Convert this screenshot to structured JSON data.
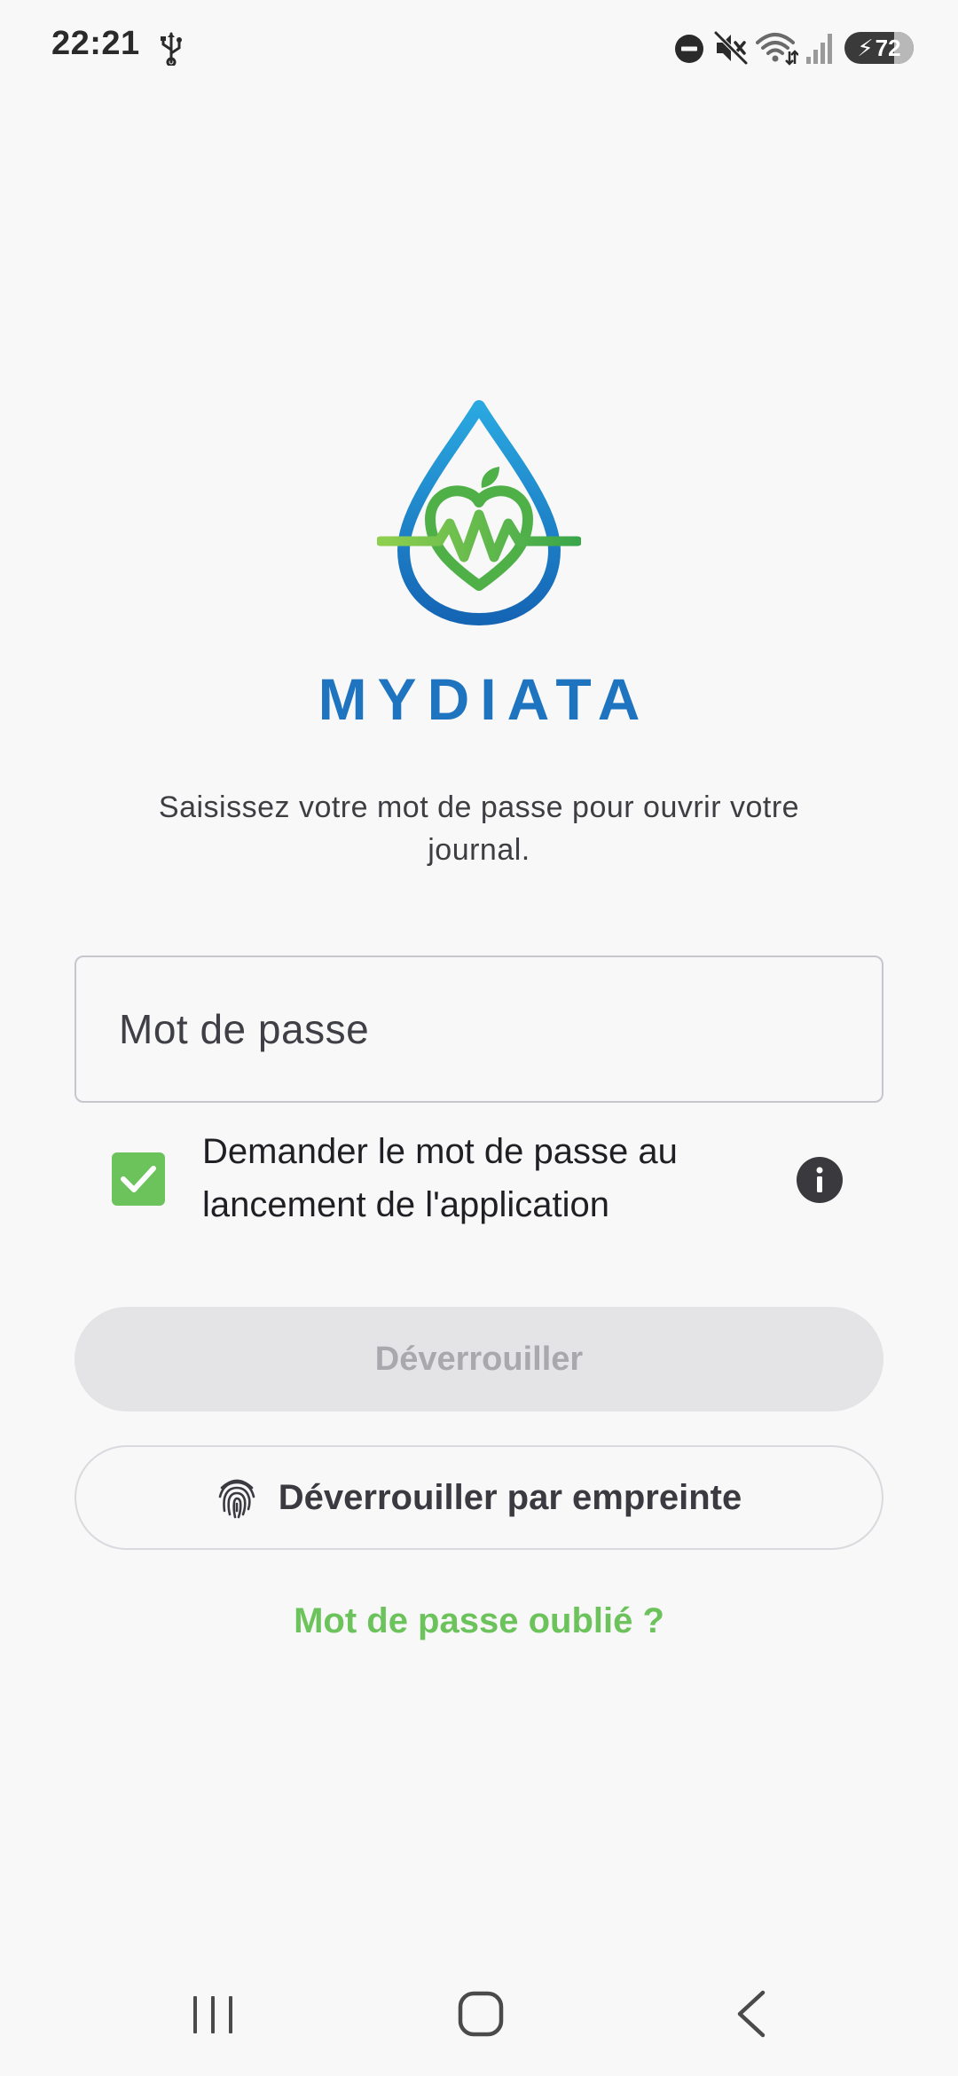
{
  "status_bar": {
    "time": "22:21",
    "battery_level": "72",
    "icons": [
      "usb-icon",
      "do-not-disturb-icon",
      "mute-icon",
      "wifi-icon",
      "signal-icon",
      "battery-icon"
    ]
  },
  "app": {
    "name": "MYDIATA",
    "subtitle": "Saisissez votre mot de passe pour ouvrir votre journal."
  },
  "password": {
    "placeholder": "Mot de passe",
    "value": ""
  },
  "remember": {
    "checked": true,
    "label": "Demander le mot de passe au lancement de l'application"
  },
  "actions": {
    "unlock_label": "Déverrouiller",
    "unlock_enabled": false,
    "fingerprint_label": "Déverrouiller par empreinte",
    "forgot_label": "Mot de passe oublié ?"
  },
  "colors": {
    "brand_blue": "#1f74c0",
    "accent_green": "#6cc35c",
    "background": "#f8f8f9"
  },
  "nav_bar": {
    "icons": [
      "recent-apps-icon",
      "home-icon",
      "back-icon"
    ]
  }
}
